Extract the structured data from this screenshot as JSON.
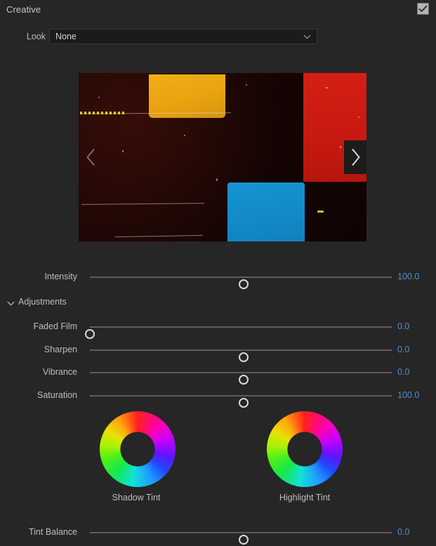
{
  "header": {
    "title": "Creative",
    "effect_toggle_icon": "checkbox-checked-icon"
  },
  "look": {
    "label": "Look",
    "value": "None",
    "caret_icon": "chevron-down-icon"
  },
  "preview": {
    "prev_icon": "chevron-left-icon",
    "next_icon": "chevron-right-icon",
    "alt": "look-preview-thumbnail"
  },
  "intensity": {
    "label": "Intensity",
    "value": "100.0",
    "knob_pct": 51
  },
  "adjustments": {
    "title": "Adjustments",
    "caret_icon": "chevron-down-icon",
    "sliders": [
      {
        "label": "Faded Film",
        "value": "0.0",
        "knob_pct": 0
      },
      {
        "label": "Sharpen",
        "value": "0.0",
        "knob_pct": 51
      },
      {
        "label": "Vibrance",
        "value": "0.0",
        "knob_pct": 51
      },
      {
        "label": "Saturation",
        "value": "100.0",
        "knob_pct": 51
      }
    ],
    "wheels": [
      {
        "label": "Shadow Tint"
      },
      {
        "label": "Highlight Tint"
      }
    ],
    "tint_balance": {
      "label": "Tint Balance",
      "value": "0.0",
      "knob_pct": 51
    }
  },
  "colors": {
    "panel_bg": "#262626",
    "value_blue": "#4a8fd2",
    "label_gray": "#bdbdbd",
    "track_gray": "#5c5c5c",
    "field_bg": "#1b1b1b"
  }
}
